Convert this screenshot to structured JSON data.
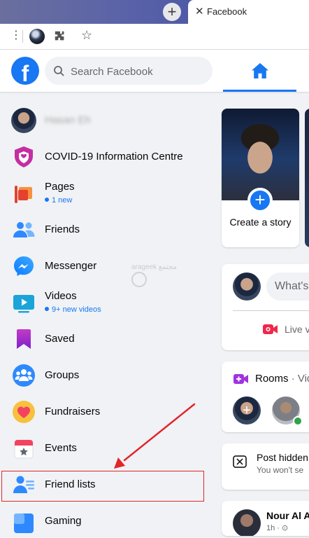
{
  "browser": {
    "tab_title": "Facebook",
    "new_tab_symbol": "+",
    "close_symbol": "✕",
    "menu_symbol": "⋮",
    "star_symbol": "☆"
  },
  "header": {
    "logo_letter": "f",
    "search_placeholder": "Search Facebook"
  },
  "sidebar": {
    "profile_name": "Hasan Eh",
    "items": [
      {
        "label": "COVID-19 Information Centre",
        "icon": "covid-shield-icon"
      },
      {
        "label": "Pages",
        "sub": "1 new",
        "icon": "pages-flag-icon"
      },
      {
        "label": "Friends",
        "icon": "friends-icon"
      },
      {
        "label": "Messenger",
        "icon": "messenger-icon"
      },
      {
        "label": "Videos",
        "sub": "9+ new videos",
        "icon": "videos-icon"
      },
      {
        "label": "Saved",
        "icon": "saved-bookmark-icon"
      },
      {
        "label": "Groups",
        "icon": "groups-icon"
      },
      {
        "label": "Fundraisers",
        "icon": "fundraisers-heart-icon"
      },
      {
        "label": "Events",
        "icon": "events-calendar-icon"
      },
      {
        "label": "Friend lists",
        "icon": "friend-lists-icon"
      },
      {
        "label": "Gaming",
        "icon": "gaming-icon"
      }
    ]
  },
  "watermark": {
    "text": "arageek مجتمع"
  },
  "feed": {
    "story": {
      "plus_symbol": "+",
      "label": "Create a story"
    },
    "composer": {
      "placeholder": "What's",
      "live_label": "Live vi"
    },
    "rooms": {
      "title": "Rooms",
      "title_cont": " · Vid",
      "add_symbol": "+"
    },
    "hidden_post": {
      "title": "Post hidden",
      "sub": "You won't se"
    },
    "post": {
      "author": "Nour Al A",
      "time": "1h · ⊙"
    }
  },
  "colors": {
    "brand": "#1877f2",
    "annotation_red": "#e3262a",
    "background": "#f0f2f5"
  }
}
